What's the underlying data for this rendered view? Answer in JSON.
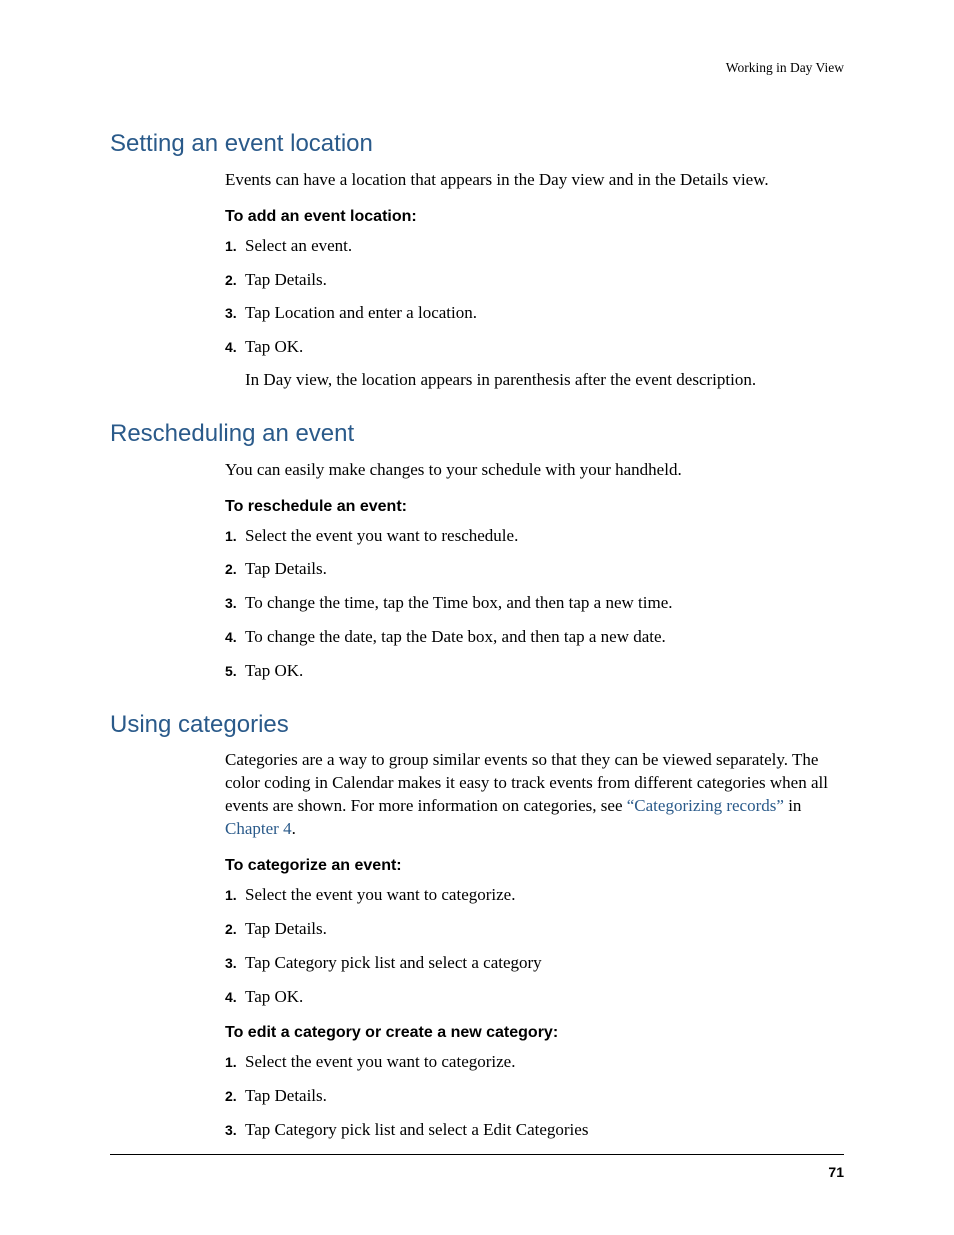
{
  "header": "Working in Day View",
  "page_number": "71",
  "sections": [
    {
      "heading": "Setting an event location",
      "intro": "Events can have a location that appears in the Day view and in the Details view.",
      "groups": [
        {
          "subhead": "To add an event location:",
          "steps": [
            "Select an event.",
            "Tap Details.",
            "Tap Location and enter a location.",
            "Tap OK."
          ],
          "note": "In Day view, the location appears in parenthesis after the event description."
        }
      ]
    },
    {
      "heading": "Rescheduling an event",
      "intro": "You can easily make changes to your schedule with your handheld.",
      "groups": [
        {
          "subhead": "To reschedule an event:",
          "steps": [
            "Select the event you want to reschedule.",
            "Tap Details.",
            "To change the time, tap the Time box, and then tap a new time.",
            "To change the date, tap the Date box, and then tap a new date.",
            "Tap OK."
          ]
        }
      ]
    },
    {
      "heading": "Using categories",
      "intro_pre_link": "Categories are a way to group similar events so that they can be viewed separately. The color coding in Calendar makes it easy to track events from different categories when all events are shown. For more information on categories, see ",
      "link1": "“Categorizing records”",
      "intro_mid": " in ",
      "link2": "Chapter 4",
      "intro_post": ".",
      "groups": [
        {
          "subhead": "To categorize an event:",
          "steps": [
            "Select the event you want to categorize.",
            "Tap Details.",
            "Tap Category pick list and select a category",
            "Tap OK."
          ]
        },
        {
          "subhead": "To edit a category or create a new category:",
          "steps": [
            "Select the event you want to categorize.",
            "Tap Details.",
            "Tap Category pick list and select a Edit Categories"
          ]
        }
      ]
    }
  ]
}
